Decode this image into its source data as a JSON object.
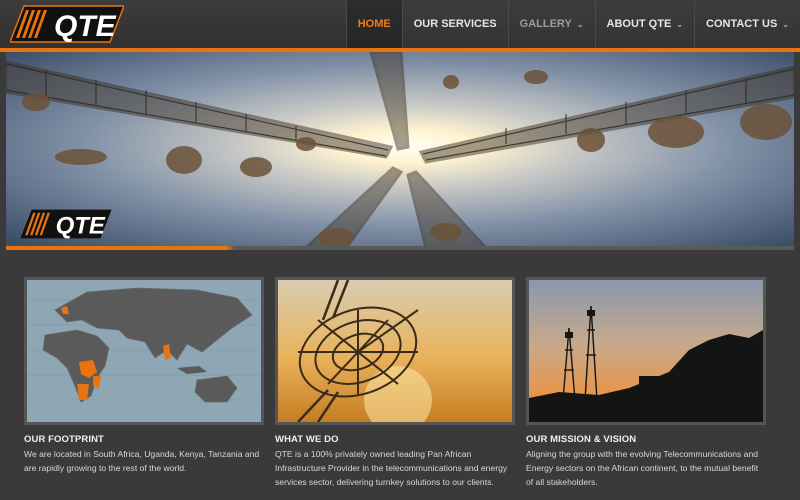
{
  "brand": {
    "name": "QTE",
    "accent": "#e9740f"
  },
  "nav": [
    {
      "label": "HOME",
      "active": true,
      "caret": false
    },
    {
      "label": "OUR SERVICES",
      "active": false,
      "caret": false
    },
    {
      "label": "GALLERY",
      "active": false,
      "caret": true
    },
    {
      "label": "ABOUT QTE",
      "active": false,
      "caret": true
    },
    {
      "label": "CONTACT US",
      "active": false,
      "caret": true
    }
  ],
  "hero": {
    "logo_text": "QTE"
  },
  "features": [
    {
      "title": "OUR FOOTPRINT",
      "text": "We are located in South Africa, Uganda, Kenya, Tanzania and are rapidly growing to the rest of the world."
    },
    {
      "title": "WHAT WE DO",
      "text": "QTE is a 100% privately owned leading Pan African Infrastructure Provider in the telecommunications and energy services sector, delivering turnkey solutions to our clients."
    },
    {
      "title": "OUR MISSION & VISION",
      "text": "Aligning the group with the evolving Telecommunications and Energy sectors on the African continent, to the mutual benefit of all stakeholders."
    }
  ]
}
